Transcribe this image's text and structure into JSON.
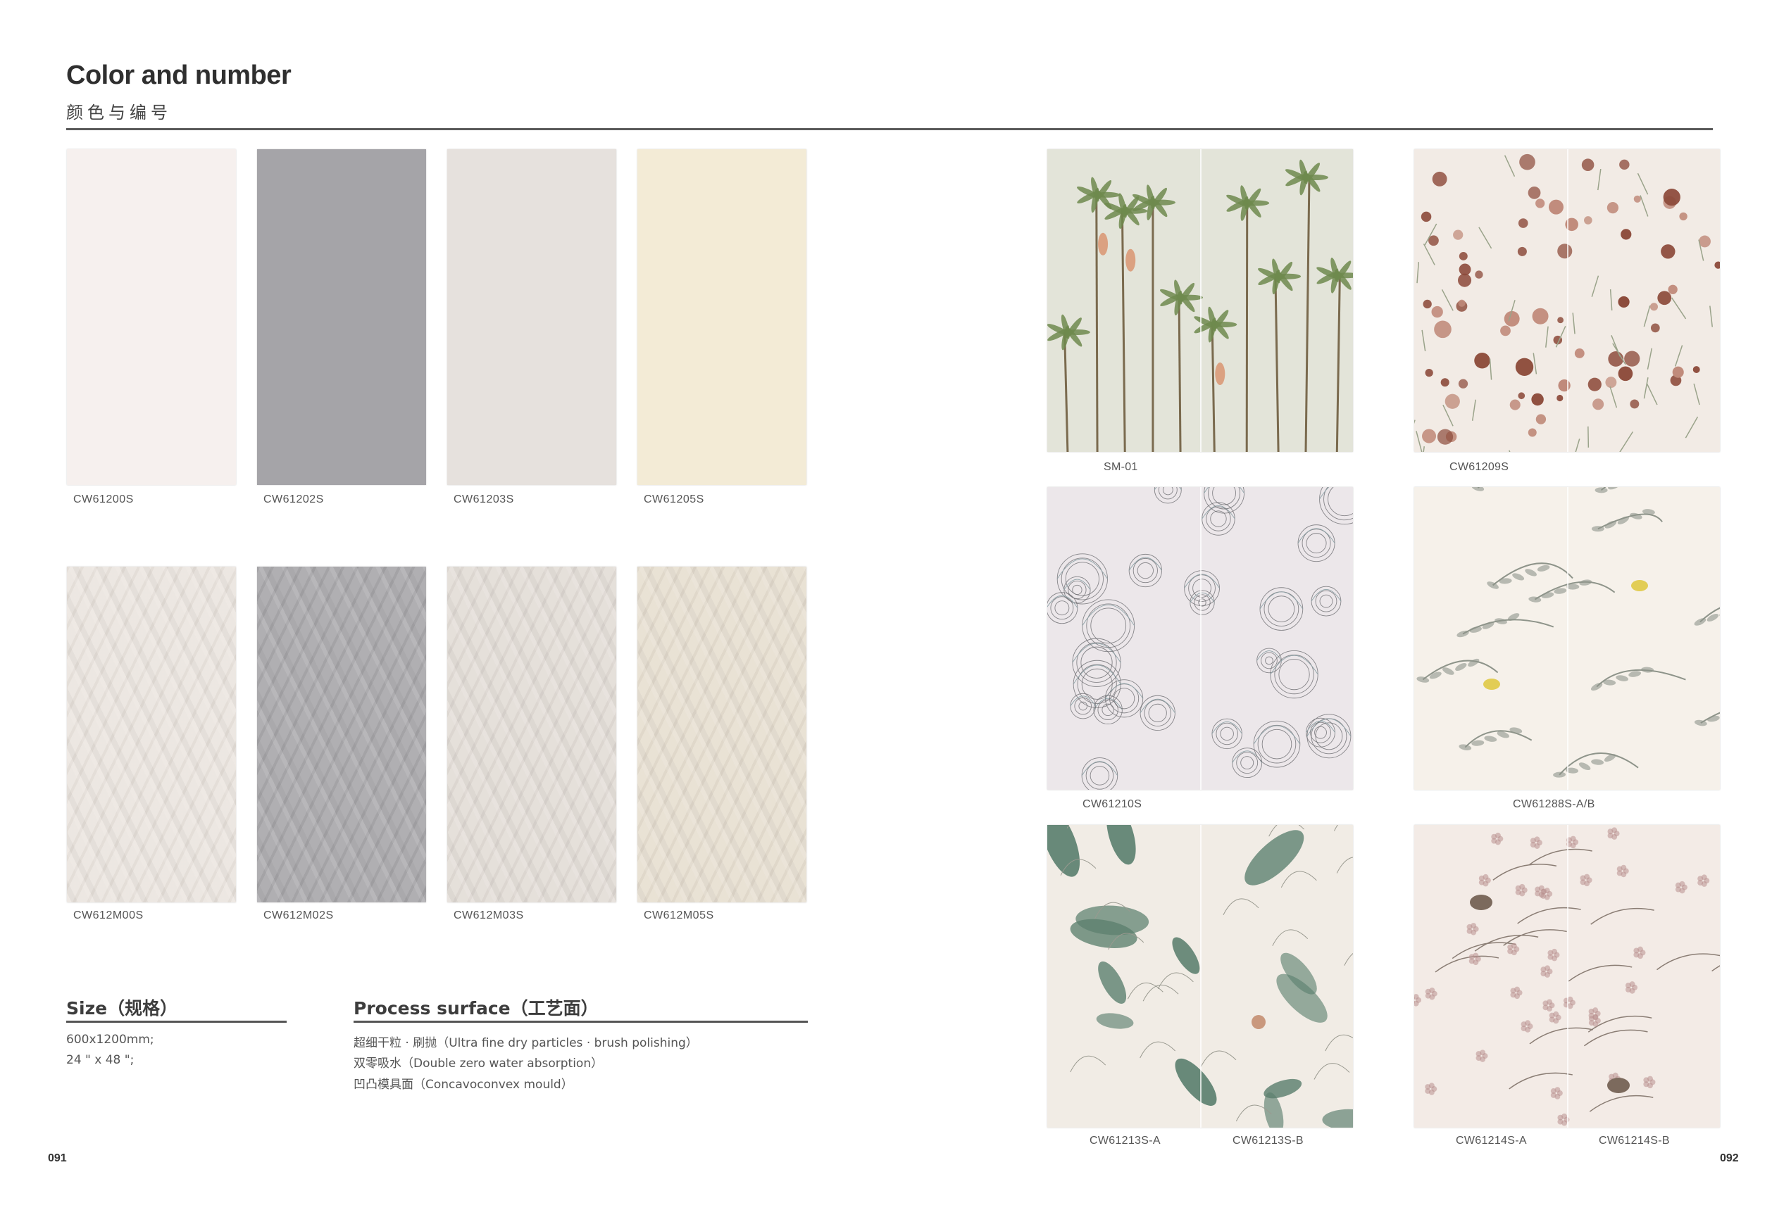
{
  "header": {
    "title": "Color and number",
    "subtitle": "颜色与编号"
  },
  "swatches_row1": [
    {
      "code": "CW61200S",
      "color": "#f6f0ee"
    },
    {
      "code": "CW61202S",
      "color": "#a5a4a8"
    },
    {
      "code": "CW61203S",
      "color": "#e6e1dd"
    },
    {
      "code": "CW61205S",
      "color": "#f3ebd6"
    }
  ],
  "swatches_row2": [
    {
      "code": "CW612M00S",
      "color": "#ebe5df"
    },
    {
      "code": "CW612M02S",
      "color": "#a9a8ab"
    },
    {
      "code": "CW612M03S",
      "color": "#e3ddd7"
    },
    {
      "code": "CW612M05S",
      "color": "#e7dfd1"
    }
  ],
  "size": {
    "title": "Size（规格）",
    "lines": [
      "600x1200mm;",
      "24 \" x 48 \";"
    ]
  },
  "process": {
    "title": "Process surface（工艺面）",
    "lines": [
      "超细干粒 · 刷抛（Ultra fine dry particles · brush polishing）",
      "双零吸水（Double zero water absorption）",
      "凹凸模具面（Concavoconvex mould）"
    ]
  },
  "patterns": [
    {
      "labels": [
        "SM-01"
      ],
      "bg": "#e3e4d9",
      "accent": "#6f8a4e",
      "accent2": "#d8906a",
      "icon": "palm-tree-pattern"
    },
    {
      "labels": [
        "CW61209S"
      ],
      "bg": "#f2ebe5",
      "accent": "#8c4a3a",
      "accent2": "#9aa38a",
      "icon": "berry-floral-pattern"
    },
    {
      "labels": [
        "CW61210S"
      ],
      "bg": "#ece7ea",
      "accent": "#6d6d70",
      "accent2": "#8ea3a8",
      "icon": "line-peony-pattern"
    },
    {
      "labels": [
        "CW61288S-A/B"
      ],
      "bg": "#f6f1ea",
      "accent": "#8e948a",
      "accent2": "#e2cd55",
      "icon": "bird-branch-pattern"
    },
    {
      "labels": [
        "CW61213S-A",
        "CW61213S-B"
      ],
      "bg": "#f1ece5",
      "accent": "#5b7f6e",
      "accent2": "#c9987d",
      "icon": "tropical-leaf-pattern"
    },
    {
      "labels": [
        "CW61214S-A",
        "CW61214S-B"
      ],
      "bg": "#f3ebe6",
      "accent": "#b88f8e",
      "accent2": "#7c6a5d",
      "icon": "blossom-bird-pattern"
    }
  ],
  "pages": {
    "left": "091",
    "right": "092"
  }
}
